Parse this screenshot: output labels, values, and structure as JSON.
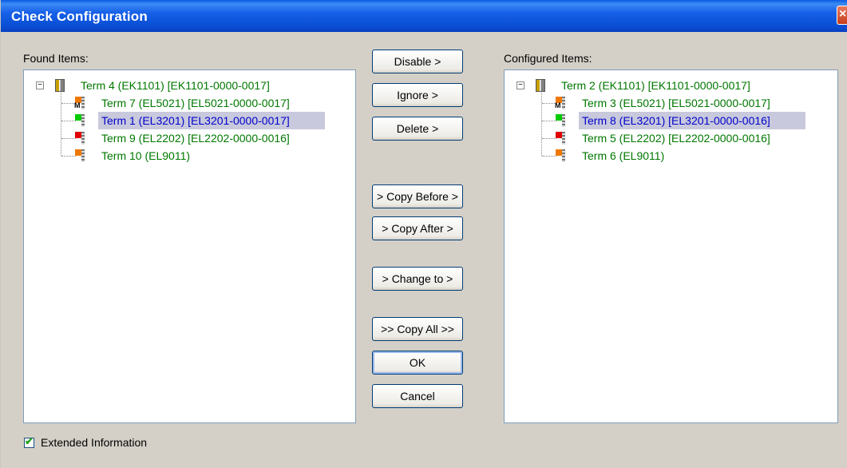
{
  "window": {
    "title": "Check Configuration"
  },
  "found": {
    "label": "Found Items:",
    "root": {
      "text": "Term 4 (EK1101)  [EK1101-0000-0017]"
    },
    "items": [
      {
        "text": "Term 7 (EL5021)  [EL5021-0000-0017]",
        "icon": "terminal-m-icon",
        "color": "#f07800",
        "selected": false
      },
      {
        "text": "Term 1 (EL3201)  [EL3201-0000-0017]",
        "icon": "terminal-green-icon",
        "color": "#00cc00",
        "selected": true
      },
      {
        "text": "Term 9 (EL2202)  [EL2202-0000-0016]",
        "icon": "terminal-red-icon",
        "color": "#e00000",
        "selected": false
      },
      {
        "text": "Term 10 (EL9011)",
        "icon": "terminal-end-icon",
        "color": "#f07800",
        "selected": false
      }
    ]
  },
  "configured": {
    "label": "Configured Items:",
    "root": {
      "text": "Term 2 (EK1101)  [EK1101-0000-0017]"
    },
    "items": [
      {
        "text": "Term 3 (EL5021)  [EL5021-0000-0017]",
        "icon": "terminal-m-icon",
        "color": "#f07800",
        "selected": false
      },
      {
        "text": "Term 8 (EL3201)  [EL3201-0000-0016]",
        "icon": "terminal-green-icon",
        "color": "#00cc00",
        "selected": true
      },
      {
        "text": "Term 5 (EL2202)  [EL2202-0000-0016]",
        "icon": "terminal-red-icon",
        "color": "#e00000",
        "selected": false
      },
      {
        "text": "Term 6 (EL9011)",
        "icon": "terminal-end-icon",
        "color": "#f07800",
        "selected": false
      }
    ]
  },
  "buttons": {
    "disable": "Disable >",
    "ignore": "Ignore >",
    "delete": "Delete >",
    "copy_before": "> Copy Before >",
    "copy_after": "> Copy After >",
    "change_to": "> Change to >",
    "copy_all": ">> Copy All >>",
    "ok": "OK",
    "cancel": "Cancel"
  },
  "extended": {
    "label": "Extended Information",
    "checked": true
  }
}
